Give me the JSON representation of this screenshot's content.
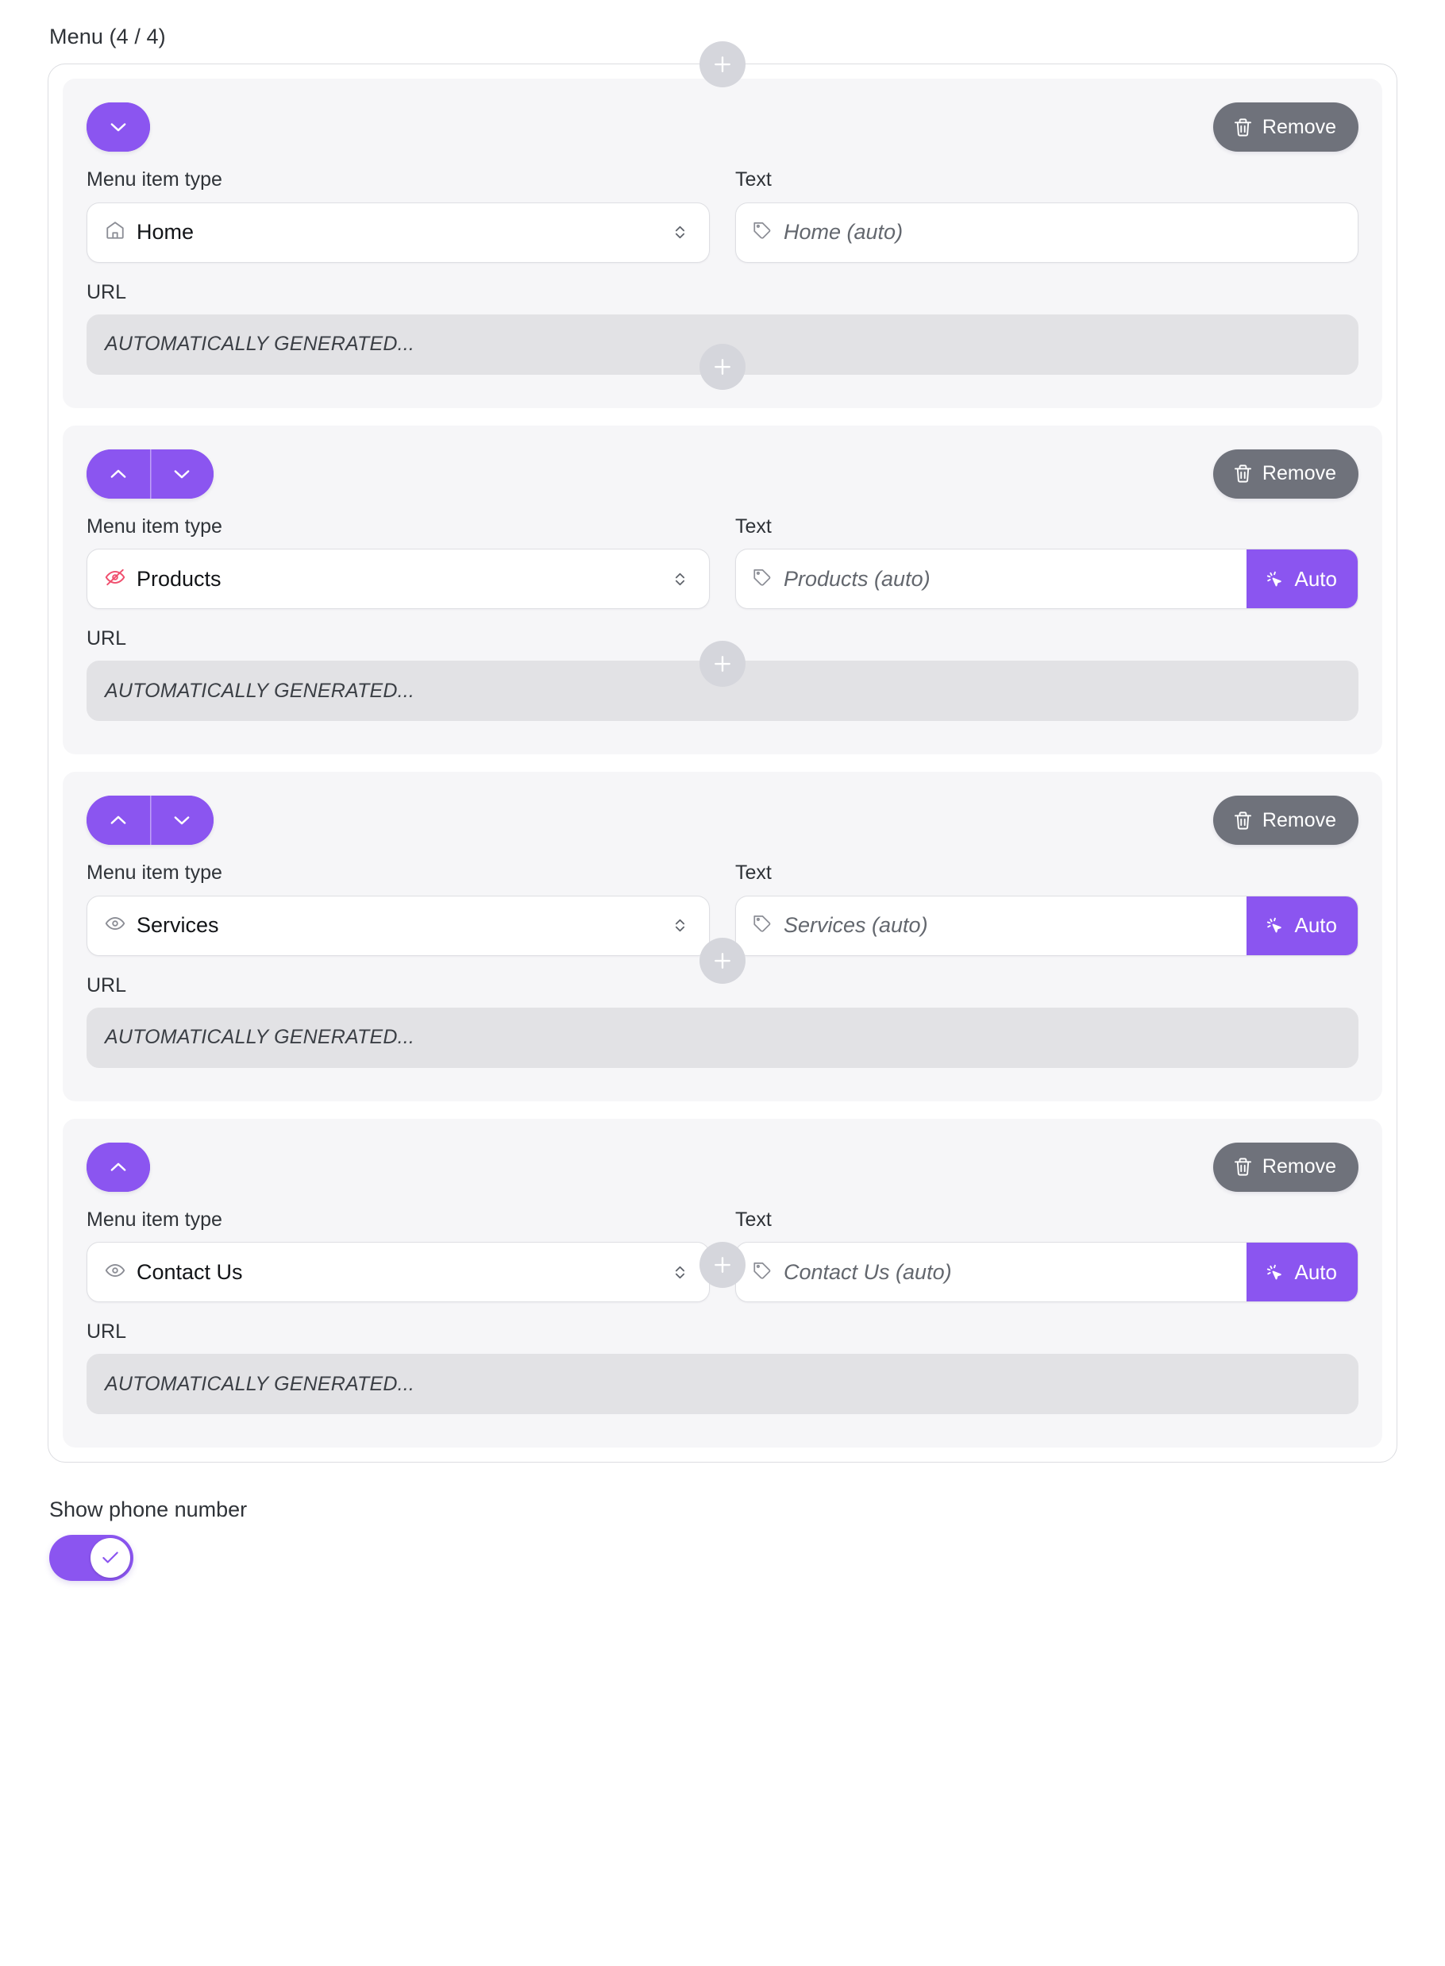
{
  "section": {
    "title": "Menu (4 / 4)"
  },
  "labels": {
    "menu_item_type": "Menu item type",
    "text": "Text",
    "url": "URL",
    "remove": "Remove",
    "auto": "Auto",
    "url_placeholder": "AUTOMATICALLY GENERATED..."
  },
  "colors": {
    "accent": "#8b55f0",
    "remove_button": "#6f727b",
    "card_background": "#f6f6f8",
    "disabled_field": "#e2e2e5",
    "plus_button": "#d5d6dc",
    "hidden_icon": "#f04f6e"
  },
  "icons": {
    "chevron_up": "chevron-up-icon",
    "chevron_down": "chevron-down-icon",
    "trash": "trash-icon",
    "plus": "plus-icon",
    "tag": "tag-icon",
    "auto_cursor": "magic-cursor-icon",
    "select_arrows": "select-arrows-icon",
    "check": "check-icon"
  },
  "menu_items": [
    {
      "type_label": "Home",
      "type_icon": "home-icon",
      "text_value": "",
      "text_placeholder": "Home (auto)",
      "url_placeholder": "AUTOMATICALLY GENERATED...",
      "has_move_up": false,
      "has_move_down": true,
      "has_auto_button": false,
      "visibility": "home"
    },
    {
      "type_label": "Products",
      "type_icon": "eye-off-icon",
      "text_value": "",
      "text_placeholder": "Products (auto)",
      "url_placeholder": "AUTOMATICALLY GENERATED...",
      "has_move_up": true,
      "has_move_down": true,
      "has_auto_button": true,
      "visibility": "hidden"
    },
    {
      "type_label": "Services",
      "type_icon": "eye-icon",
      "text_value": "",
      "text_placeholder": "Services (auto)",
      "url_placeholder": "AUTOMATICALLY GENERATED...",
      "has_move_up": true,
      "has_move_down": true,
      "has_auto_button": true,
      "visibility": "visible"
    },
    {
      "type_label": "Contact Us",
      "type_icon": "eye-icon",
      "text_value": "",
      "text_placeholder": "Contact Us (auto)",
      "url_placeholder": "AUTOMATICALLY GENERATED...",
      "has_move_up": true,
      "has_move_down": false,
      "has_auto_button": true,
      "visibility": "visible"
    }
  ],
  "footer": {
    "show_phone_number_label": "Show phone number",
    "show_phone_number_enabled": true
  }
}
